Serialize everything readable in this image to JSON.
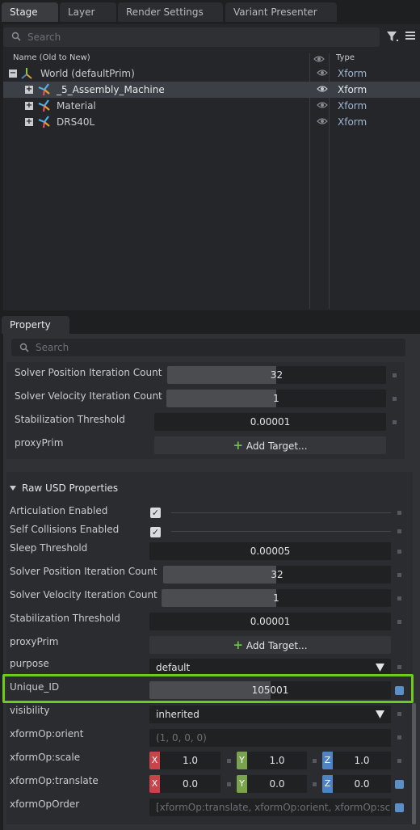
{
  "tabs": {
    "stage": "Stage",
    "layer": "Layer",
    "render_settings": "Render Settings",
    "variant_presenter": "Variant Presenter"
  },
  "stage": {
    "search_placeholder": "Search",
    "col_name": "Name (Old to New)",
    "col_type": "Type",
    "rows": [
      {
        "label": "World (defaultPrim)",
        "type": "Xform"
      },
      {
        "label": "_5_Assembly_Machine",
        "type": "Xform"
      },
      {
        "label": "Material",
        "type": "Xform"
      },
      {
        "label": "DRS40L",
        "type": "Xform"
      }
    ]
  },
  "property": {
    "tab": "Property",
    "search_placeholder": "Search",
    "upper": {
      "solver_pos_label": "Solver Position Iteration Count",
      "solver_pos_value": "32",
      "solver_vel_label": "Solver Velocity Iteration Count",
      "solver_vel_value": "1",
      "stab_label": "Stabilization Threshold",
      "stab_value": "0.00001",
      "proxy_label": "proxyPrim",
      "proxy_button": "Add Target..."
    },
    "raw": {
      "header": "Raw USD Properties",
      "articulation_label": "Articulation Enabled",
      "self_coll_label": "Self Collisions Enabled",
      "sleep_label": "Sleep Threshold",
      "sleep_value": "0.00005",
      "solver_pos_label": "Solver Position Iteration Count",
      "solver_pos_value": "32",
      "solver_vel_label": "Solver Velocity Iteration Count",
      "solver_vel_value": "1",
      "stab_label": "Stabilization Threshold",
      "stab_value": "0.00001",
      "proxy_label": "proxyPrim",
      "proxy_button": "Add Target...",
      "purpose_label": "purpose",
      "purpose_value": "default",
      "unique_label": "Unique_ID",
      "unique_value": "105001",
      "visibility_label": "visibility",
      "visibility_value": "inherited",
      "orient_label": "xformOp:orient",
      "orient_value": "(1, 0, 0, 0)",
      "scale_label": "xformOp:scale",
      "scale_x": "1.0",
      "scale_y": "1.0",
      "scale_z": "1.0",
      "translate_label": "xformOp:translate",
      "translate_x": "0.0",
      "translate_y": "0.0",
      "translate_z": "0.0",
      "order_label": "xformOpOrder",
      "order_value": "[xformOp:translate, xformOp:orient, xformOp:scale"
    },
    "axis_x": "X",
    "axis_y": "Y",
    "axis_z": "Z"
  },
  "colors": {
    "highlight": "#6dcc1a",
    "accent_blue": "#5b8fc7"
  }
}
